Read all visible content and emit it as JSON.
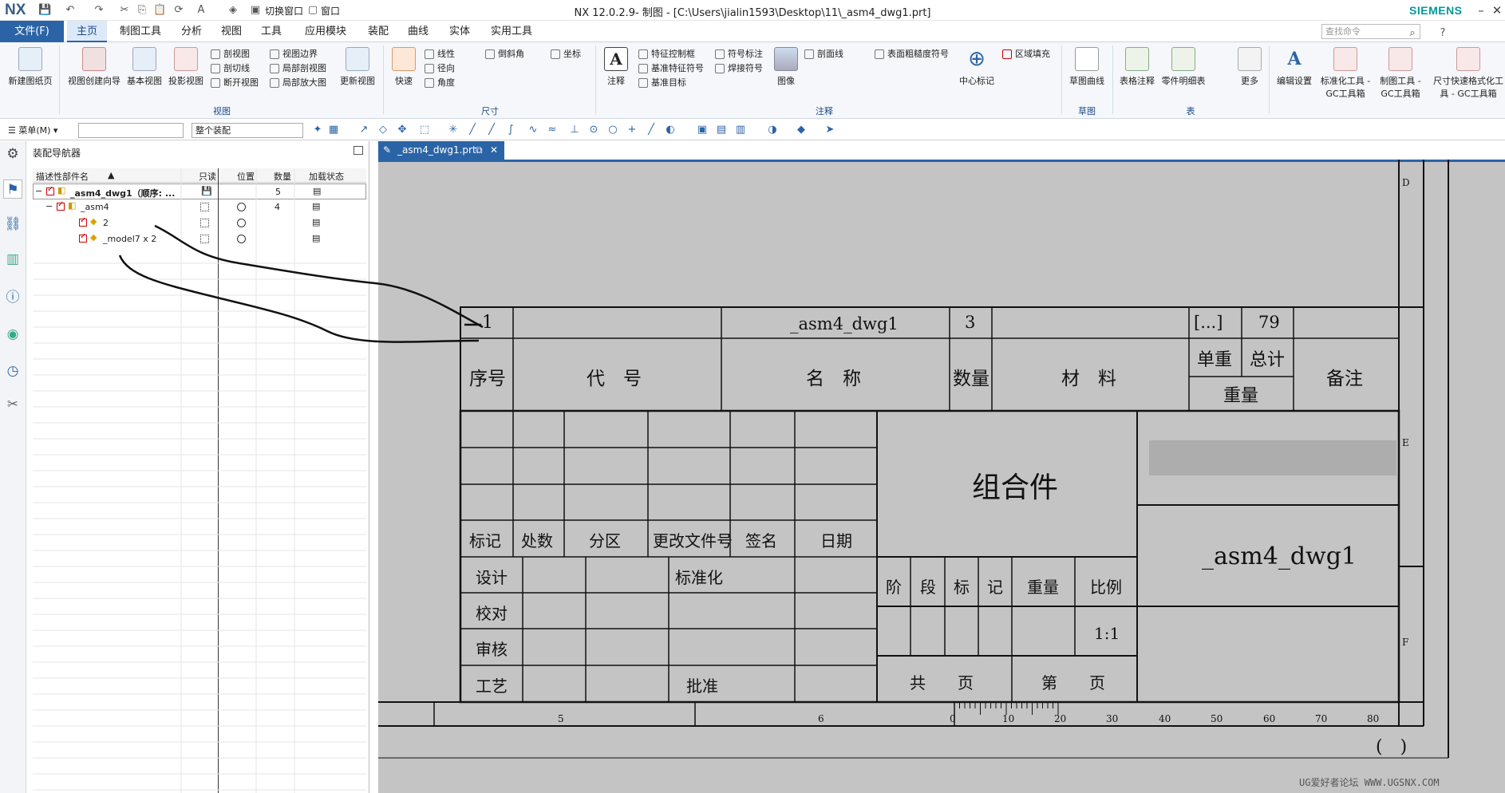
{
  "title": {
    "app_logo": "NX",
    "window_title": "NX 12.0.2.9- 制图 - [C:\\Users\\jialin1593\\Desktop\\11\\_asm4_dwg1.prt]",
    "brand": "SIEMENS",
    "switch_window": "切换窗口",
    "window_menu": "窗口"
  },
  "tabs": {
    "file": "文件(F)",
    "items": [
      "主页",
      "制图工具",
      "分析",
      "视图",
      "工具",
      "应用模块",
      "装配",
      "曲线",
      "实体",
      "实用工具"
    ]
  },
  "search": {
    "placeholder": "查找命令"
  },
  "ribbon": {
    "new_sheet": "新建图纸页",
    "view_wizard": "视图创建向导",
    "base_view": "基本视图",
    "proj_view": "投影视图",
    "sec_view": "剖视图",
    "sec_line": "剖切线",
    "break_view": "断开视图",
    "view_border": "视图边界",
    "local_sec": "局部剖视图",
    "detail_view": "局部放大图",
    "update_view": "更新视图",
    "quick": "快速",
    "linear": "线性",
    "radial": "径向",
    "angle": "角度",
    "chamfer": "倒斜角",
    "coord": "坐标",
    "note": "注释",
    "fcf": "特征控制框",
    "datum_feature": "基准特征符号",
    "datum_target": "基准目标",
    "symbol_note": "符号标注",
    "weld": "焊接符号",
    "image": "图像",
    "hatch": "剖面线",
    "surface": "表面粗糙度符号",
    "centermark": "中心标记",
    "area_fill": "区域填充",
    "sketch_curve": "草图曲线",
    "table_note": "表格注释",
    "parts_list": "零件明细表",
    "more": "更多",
    "edit_settings": "编辑设置",
    "std_tool": "标准化工具 - GC工具箱",
    "draft_tool": "制图工具 - GC工具箱",
    "dim_tool": "尺寸快速格式化工具 - GC工具箱",
    "groups": {
      "view": "视图",
      "dim": "尺寸",
      "anno": "注释",
      "sketch": "草图",
      "table": "表"
    }
  },
  "toolbar": {
    "menu": "菜单(M)",
    "filter": "",
    "scope": "整个装配"
  },
  "nav": {
    "title": "装配导航器",
    "cols": [
      "描述性部件名",
      "只读",
      "位置",
      "数量",
      "加载状态"
    ],
    "rows": [
      {
        "name": "_asm4_dwg1（顺序: ...",
        "qty": "5"
      },
      {
        "name": "_asm4",
        "qty": "4"
      },
      {
        "name": "2",
        "qty": ""
      },
      {
        "name": "_model7 x 2",
        "qty": ""
      }
    ]
  },
  "doc_tab": "_asm4_dwg1.prt",
  "drawing": {
    "bom_row": {
      "index": "1",
      "name": "_asm4_dwg1",
      "qty": "3",
      "weight_code": "[...]",
      "weight_total": "79"
    },
    "bom_hdr": {
      "index": "序号",
      "code": "代　号",
      "name": "名　称",
      "qty": "数量",
      "material": "材　料",
      "unit": "单重",
      "total": "总计",
      "weight": "重量",
      "remark": "备注"
    },
    "title_block": {
      "assembly": "组合件",
      "drawing_name": "_asm4_dwg1",
      "scale": "1:1",
      "mark": "标记",
      "count": "处数",
      "zone": "分区",
      "change_doc": "更改文件号",
      "signature": "签名",
      "date": "日期",
      "design": "设计",
      "standardize": "标准化",
      "check": "校对",
      "review": "审核",
      "process": "工艺",
      "approve": "批准",
      "stage": "阶",
      "segment": "段",
      "marker": "标",
      "record": "记",
      "weight": "重量",
      "ratio": "比例",
      "total_sheets": "共　　页",
      "sheet_no": "第　　页",
      "paren": "(　)"
    },
    "border_letters": [
      "D",
      "E",
      "F"
    ],
    "ruler": [
      "5",
      "6",
      "0",
      "10",
      "20",
      "30",
      "40",
      "50",
      "60",
      "70",
      "80"
    ]
  },
  "watermark": "UG爱好者论坛 WWW.UGSNX.COM"
}
